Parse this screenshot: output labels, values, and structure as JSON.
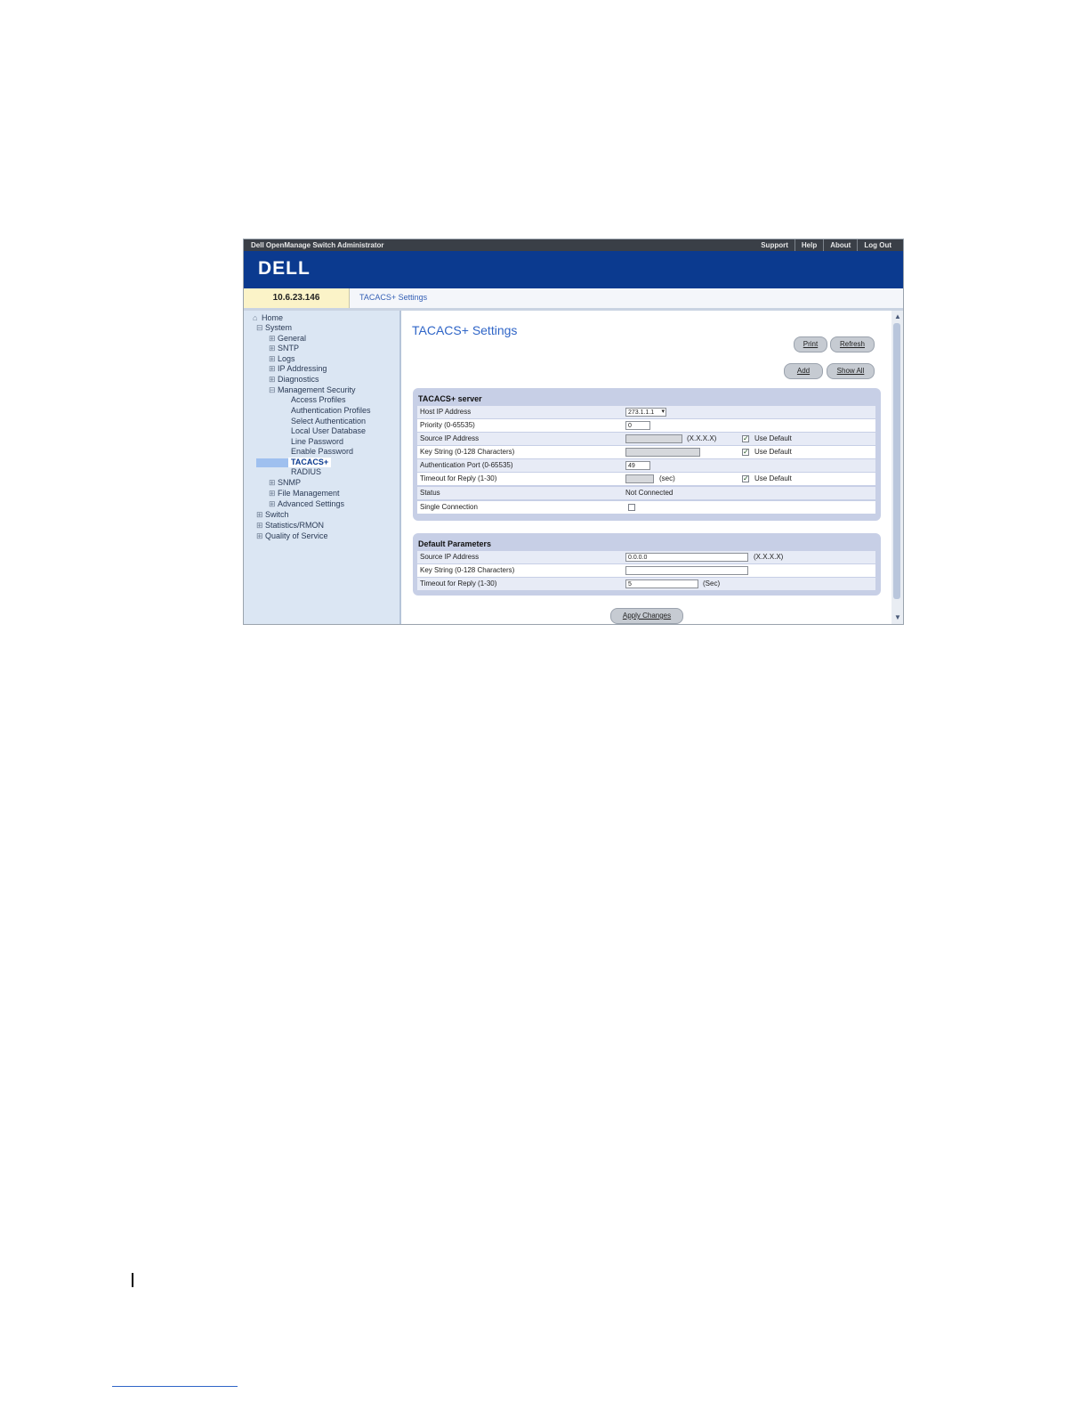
{
  "window": {
    "app_title": "Dell OpenManage Switch Administrator",
    "top_links": [
      "Support",
      "Help",
      "About",
      "Log Out"
    ],
    "logo": "DELL"
  },
  "crumbbar": {
    "ip": "10.6.23.146",
    "breadcrumb": "TACACS+ Settings"
  },
  "tree": {
    "home": "Home",
    "system": "System",
    "general": "General",
    "sntp": "SNTP",
    "logs": "Logs",
    "ip_addressing": "IP Addressing",
    "diagnostics": "Diagnostics",
    "mgmt_security": "Management Security",
    "access_profiles": "Access Profiles",
    "auth_profiles": "Authentication Profiles",
    "select_auth": "Select Authentication",
    "local_user_db": "Local User Database",
    "line_password": "Line Password",
    "enable_password": "Enable Password",
    "tacacs": "TACACS+",
    "radius": "RADIUS",
    "snmp": "SNMP",
    "file_mgmt": "File Management",
    "advanced": "Advanced Settings",
    "switch": "Switch",
    "stats": "Statistics/RMON",
    "qos": "Quality of Service"
  },
  "page": {
    "title": "TACACS+ Settings",
    "print": "Print",
    "refresh": "Refresh",
    "add": "Add",
    "show_all": "Show All",
    "apply": "Apply Changes"
  },
  "server": {
    "title": "TACACS+ server",
    "host_ip_label": "Host IP Address",
    "host_ip_value": "273.1.1.1",
    "priority_label": "Priority (0-65535)",
    "priority_value": "0",
    "source_ip_label": "Source IP Address",
    "source_ip_hint": "(X.X.X.X)",
    "use_default": "Use Default",
    "key_label": "Key String (0-128 Characters)",
    "auth_port_label": "Authentication Port (0-65535)",
    "auth_port_value": "49",
    "timeout_label": "Timeout for Reply (1-30)",
    "timeout_hint": "(sec)",
    "status_label": "Status",
    "status_value": "Not Connected",
    "single_conn_label": "Single Connection"
  },
  "defaults": {
    "title": "Default Parameters",
    "source_ip_label": "Source IP Address",
    "source_ip_value": "0.0.0.0",
    "source_ip_hint": "(X.X.X.X)",
    "key_label": "Key String (0-128 Characters)",
    "timeout_label": "Timeout for Reply (1-30)",
    "timeout_value": "5",
    "timeout_hint": "(Sec)"
  }
}
